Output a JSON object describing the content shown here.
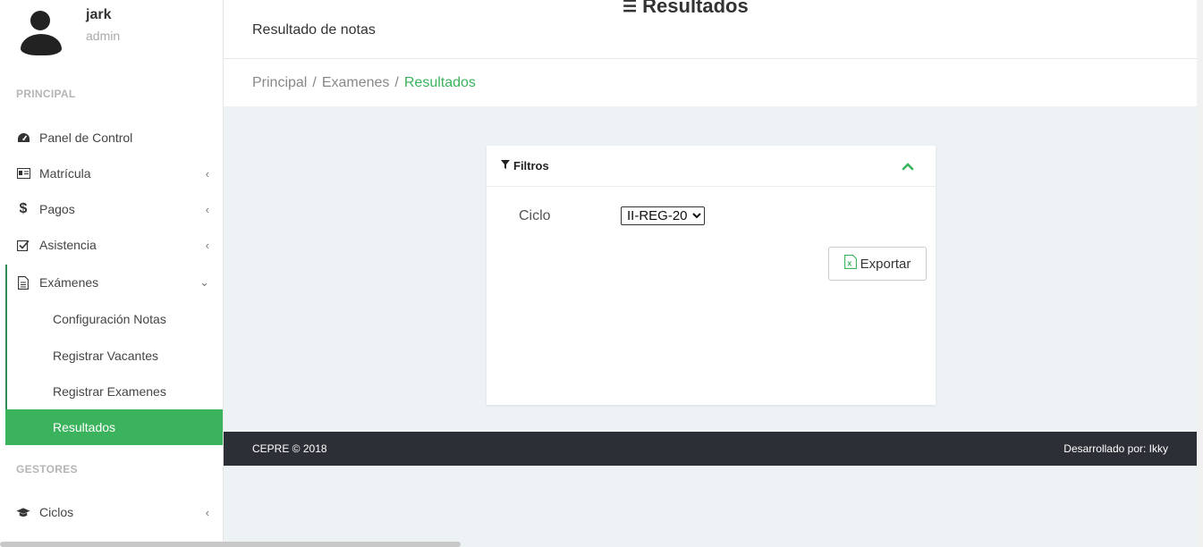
{
  "user": {
    "name": "jark",
    "role": "admin"
  },
  "sidebar": {
    "section_principal": "PRINCIPAL",
    "items": [
      {
        "label": "Panel de Control",
        "icon": "dashboard-icon"
      },
      {
        "label": "Matrícula",
        "icon": "id-card-icon",
        "chevron": "‹"
      },
      {
        "label": "Pagos",
        "icon": "dollar-icon",
        "chevron": "‹"
      },
      {
        "label": "Asistencia",
        "icon": "check-square-icon",
        "chevron": "‹"
      },
      {
        "label": "Exámenes",
        "icon": "file-text-icon",
        "chevron": "⌄"
      }
    ],
    "subitems": [
      {
        "label": "Configuración Notas"
      },
      {
        "label": "Registrar Vacantes"
      },
      {
        "label": "Registrar Examenes"
      },
      {
        "label": "Resultados",
        "active": true
      }
    ],
    "section_gestores": "GESTORES",
    "gestores_items": [
      {
        "label": "Ciclos",
        "icon": "graduation-cap-icon",
        "chevron": "‹"
      }
    ]
  },
  "header": {
    "subtitle": "Resultado de notas",
    "title": "Resultados"
  },
  "breadcrumb": {
    "items": [
      "Principal",
      "Examenes"
    ],
    "current": "Resultados",
    "separator": "/"
  },
  "filters": {
    "title": "Filtros",
    "ciclo_label": "Ciclo",
    "ciclo_selected": "II-REG-20",
    "export_label": "Exportar"
  },
  "footer": {
    "left": "CEPRE © 2018",
    "right": "Desarrollado por: Ikky"
  },
  "colors": {
    "accent": "#3bb35c",
    "footer_bg": "#2c3036",
    "content_bg": "#edf2f5"
  }
}
